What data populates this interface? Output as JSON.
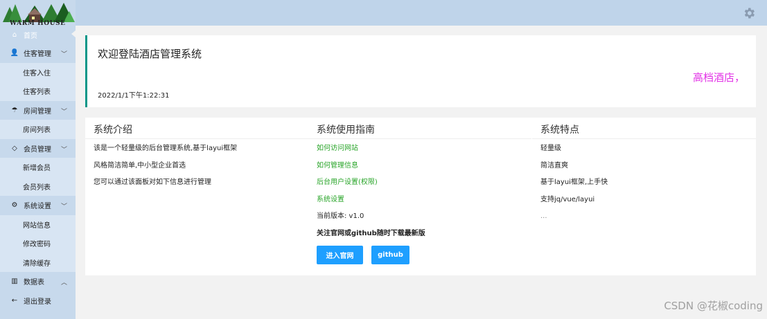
{
  "logo": {
    "text": "WARM HOUSE"
  },
  "sidebar": {
    "home": "首页",
    "groups": [
      {
        "label": "住客管理",
        "items": [
          "住客入住",
          "住客列表"
        ]
      },
      {
        "label": "房间管理",
        "items": [
          "房间列表"
        ]
      },
      {
        "label": "会员管理",
        "items": [
          "新增会员",
          "会员列表"
        ]
      },
      {
        "label": "系统设置",
        "items": [
          "网站信息",
          "修改密码",
          "清除缓存"
        ]
      }
    ],
    "datatable": "数据表",
    "logout": "退出登录"
  },
  "welcome": {
    "title": "欢迎登陆酒店管理系统",
    "slogan": "高档酒店，",
    "time": "2022/1/1下午1:22:31"
  },
  "intro": {
    "title": "系统介绍",
    "lines": [
      "该是一个轻量级的后台管理系统,基于layui框架",
      "风格简洁简单,中小型企业首选",
      "您可以通过该面板对如下信息进行管理"
    ]
  },
  "guide": {
    "title": "系统使用指南",
    "links": [
      "如何访问网站",
      "如何管理信息",
      "后台用户设置(权限)",
      "系统设置"
    ],
    "version": "当前版本: v1.0",
    "notice": "关注官网或github随时下载最新版",
    "btn_official": "进入官网",
    "btn_github": "github"
  },
  "features": {
    "title": "系统特点",
    "lines": [
      "轻量级",
      "简洁直爽",
      "基于layui框架,上手快",
      "支持jq/vue/layui",
      "..."
    ]
  },
  "watermark": "CSDN @花椒coding",
  "colors": {
    "accent": "#009688",
    "button": "#1e9fff",
    "link": "#2aa52a",
    "slogan": "#e231e6",
    "sidebar": "#c7d9ec"
  }
}
